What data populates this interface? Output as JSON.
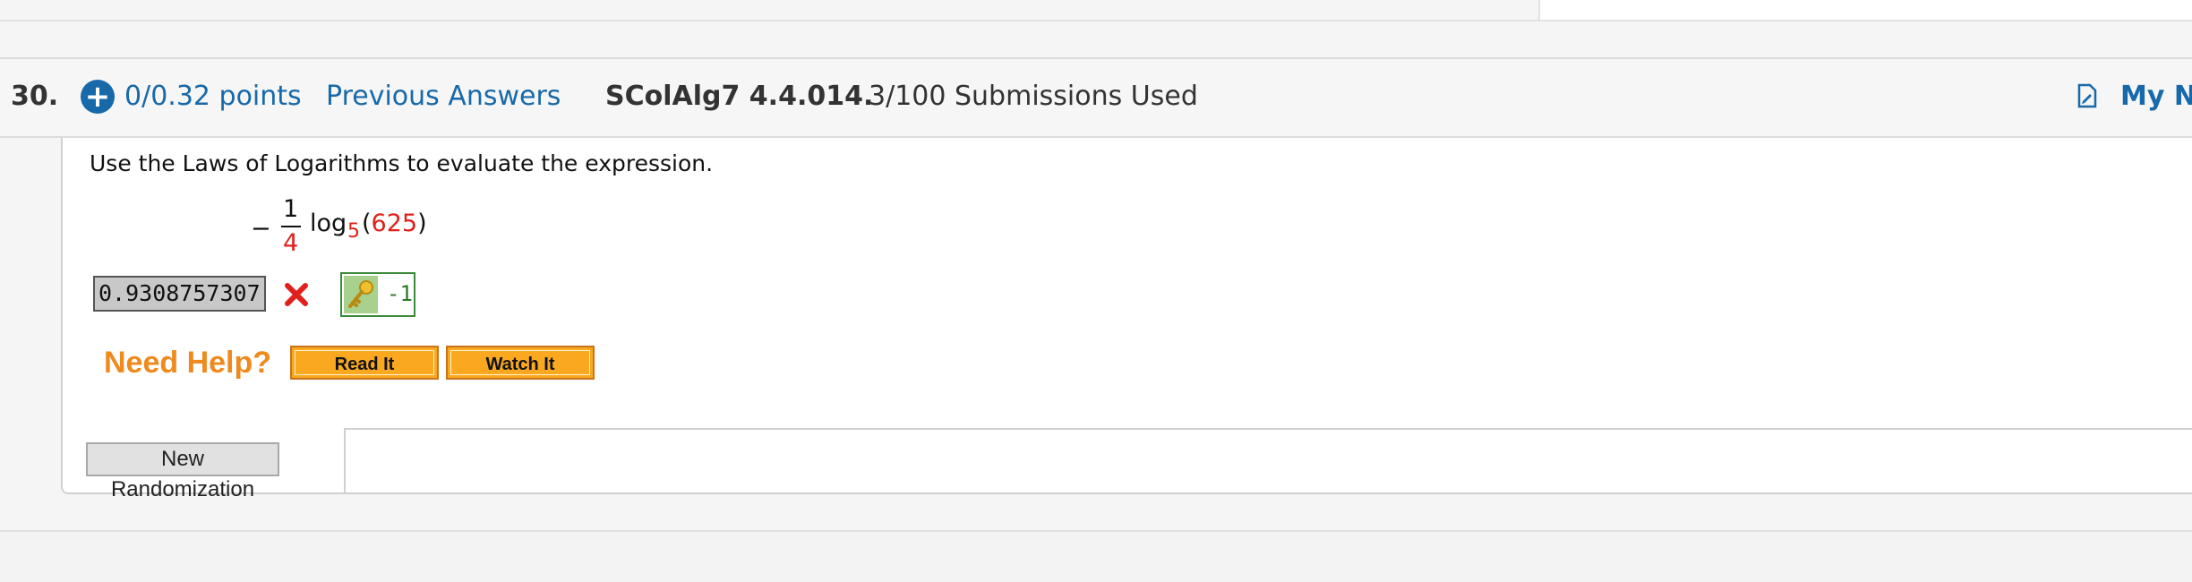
{
  "header": {
    "number": "30.",
    "points": "0/0.32 points",
    "previous_answers": "Previous Answers",
    "code": "SColAlg7 4.4.014.",
    "submissions": "3/100 Submissions Used",
    "my_notes": "My No"
  },
  "question": {
    "prompt": "Use the Laws of Logarithms to evaluate the expression.",
    "expression": {
      "minus": "−",
      "numerator": "1",
      "denominator": "4",
      "log": "log",
      "base": "5",
      "open_paren": "(",
      "argument": "625",
      "close_paren": ")"
    },
    "answer_value": "0.9308757307",
    "answer_status": "incorrect",
    "key_value": "-1"
  },
  "help": {
    "label": "Need Help?",
    "read_it": "Read It",
    "watch_it": "Watch It"
  },
  "buttons": {
    "new_randomization": "New Randomization"
  },
  "colors": {
    "link_blue": "#1769aa",
    "error_red": "#e0201b",
    "help_orange": "#ee8a1e",
    "correct_green": "#2a7a2a"
  }
}
